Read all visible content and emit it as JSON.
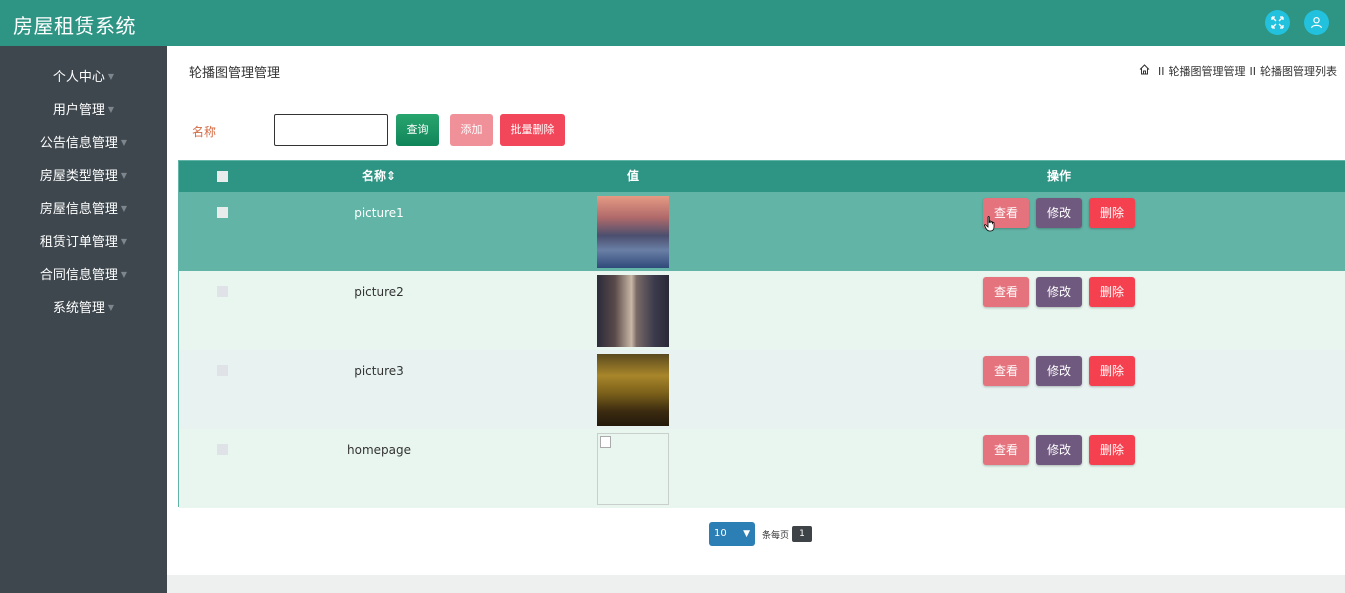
{
  "app": {
    "title": "房屋租赁系统"
  },
  "header_icons": [
    "fullscreen-icon",
    "user-icon"
  ],
  "sidebar": {
    "items": [
      {
        "label": "个人中心"
      },
      {
        "label": "用户管理"
      },
      {
        "label": "公告信息管理"
      },
      {
        "label": "房屋类型管理"
      },
      {
        "label": "房屋信息管理"
      },
      {
        "label": "租赁订单管理"
      },
      {
        "label": "合同信息管理"
      },
      {
        "label": "系统管理"
      }
    ]
  },
  "page": {
    "heading": "轮播图管理管理",
    "breadcrumb": [
      "轮播图管理管理",
      "轮播图管理列表"
    ],
    "breadcrumb_sep": "II"
  },
  "filter": {
    "label": "名称",
    "value": "",
    "search_label": "查询",
    "add_label": "添加",
    "batch_delete_label": "批量删除"
  },
  "table": {
    "columns": [
      "名称",
      "值",
      "操作"
    ],
    "sort_mark": "⇕",
    "rows": [
      {
        "name": "picture1",
        "image": "sunset-water-image",
        "has_image": true
      },
      {
        "name": "picture2",
        "image": "city-tower-night-image",
        "has_image": true
      },
      {
        "name": "picture3",
        "image": "golden-city-skyline-image",
        "has_image": true
      },
      {
        "name": "homepage",
        "image": "broken-image",
        "has_image": false
      }
    ],
    "actions": {
      "view": "查看",
      "edit": "修改",
      "delete": "删除"
    }
  },
  "pagination": {
    "page_size": "10",
    "per_page_label": "条每页",
    "current_page": "1"
  },
  "colors": {
    "header": "#2e9484",
    "sidebar": "#3e474e",
    "row_hover": "#62b5a6",
    "row_light": "#e8f6ef",
    "view": "#e5737d",
    "edit": "#70597f",
    "delete": "#f5414f"
  }
}
